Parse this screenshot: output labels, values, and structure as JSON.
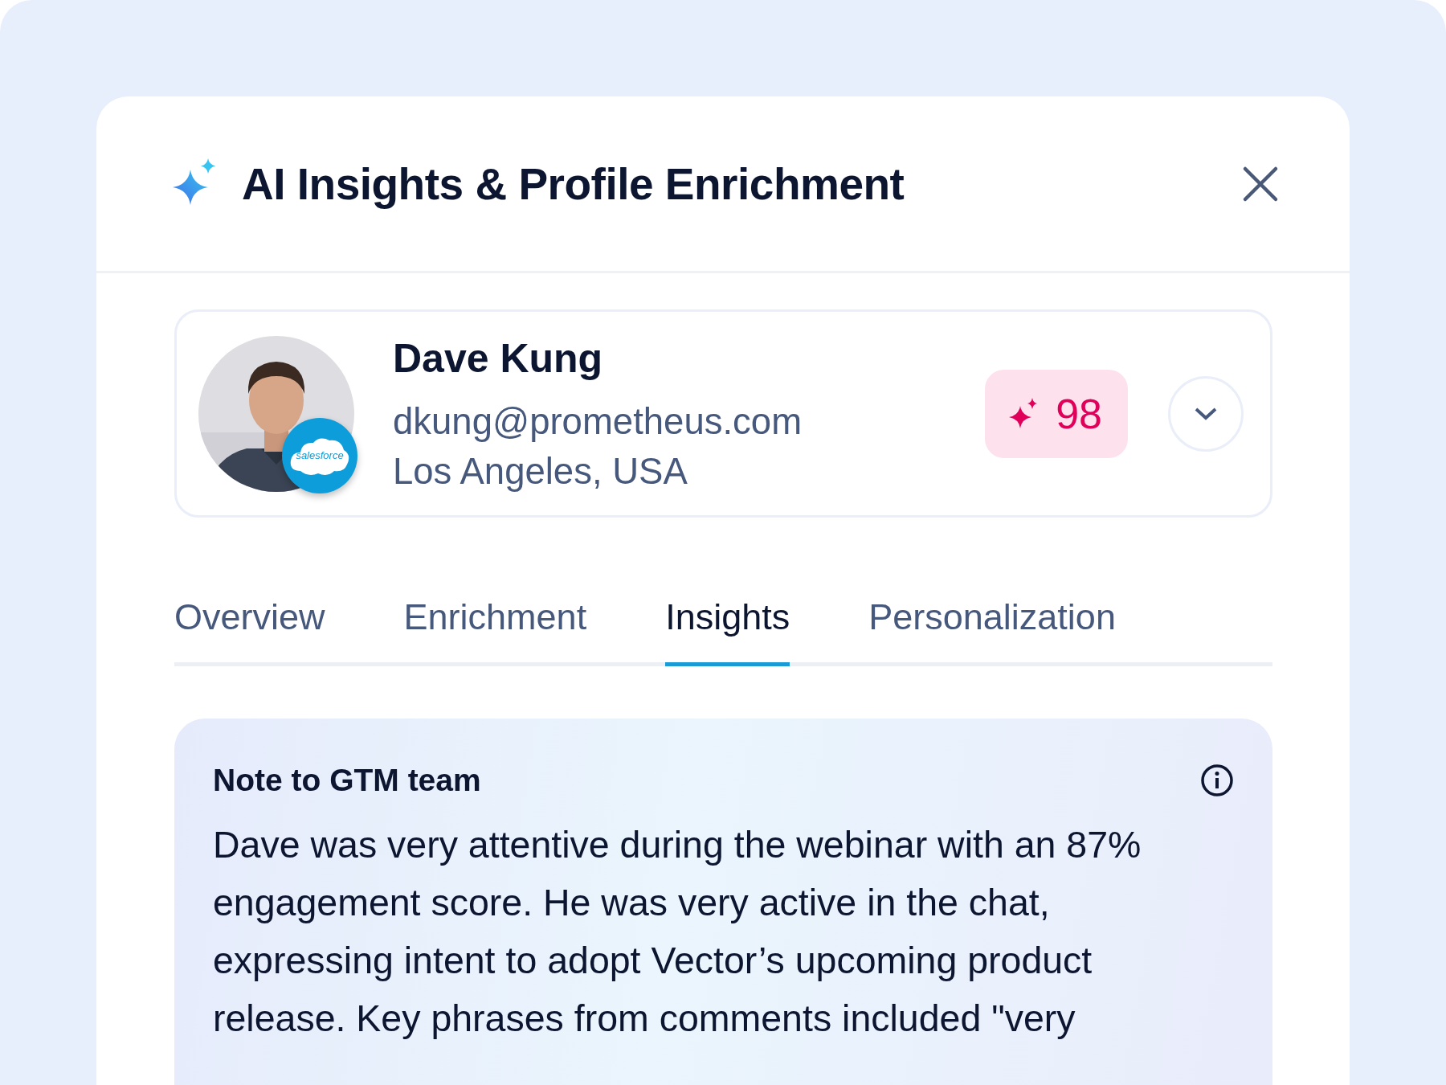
{
  "header": {
    "title": "AI Insights & Profile Enrichment"
  },
  "profile": {
    "name": "Dave Kung",
    "email": "dkung@prometheus.com",
    "location": "Los Angeles, USA",
    "avatar": {
      "kind": "picture",
      "badge_label": "salesforce"
    },
    "score": "98"
  },
  "tabs": [
    {
      "label": "Overview",
      "selected": false
    },
    {
      "label": "Enrichment",
      "selected": false
    },
    {
      "label": "Insights",
      "selected": true
    },
    {
      "label": "Personalization",
      "selected": false
    }
  ],
  "note": {
    "title": "Note to GTM team",
    "text": "Dave was very attentive during the webinar with an 87% engagement score. He was very active in the chat, expressing intent to adopt Vector’s upcoming product release. Key phrases from comments included \"very"
  }
}
